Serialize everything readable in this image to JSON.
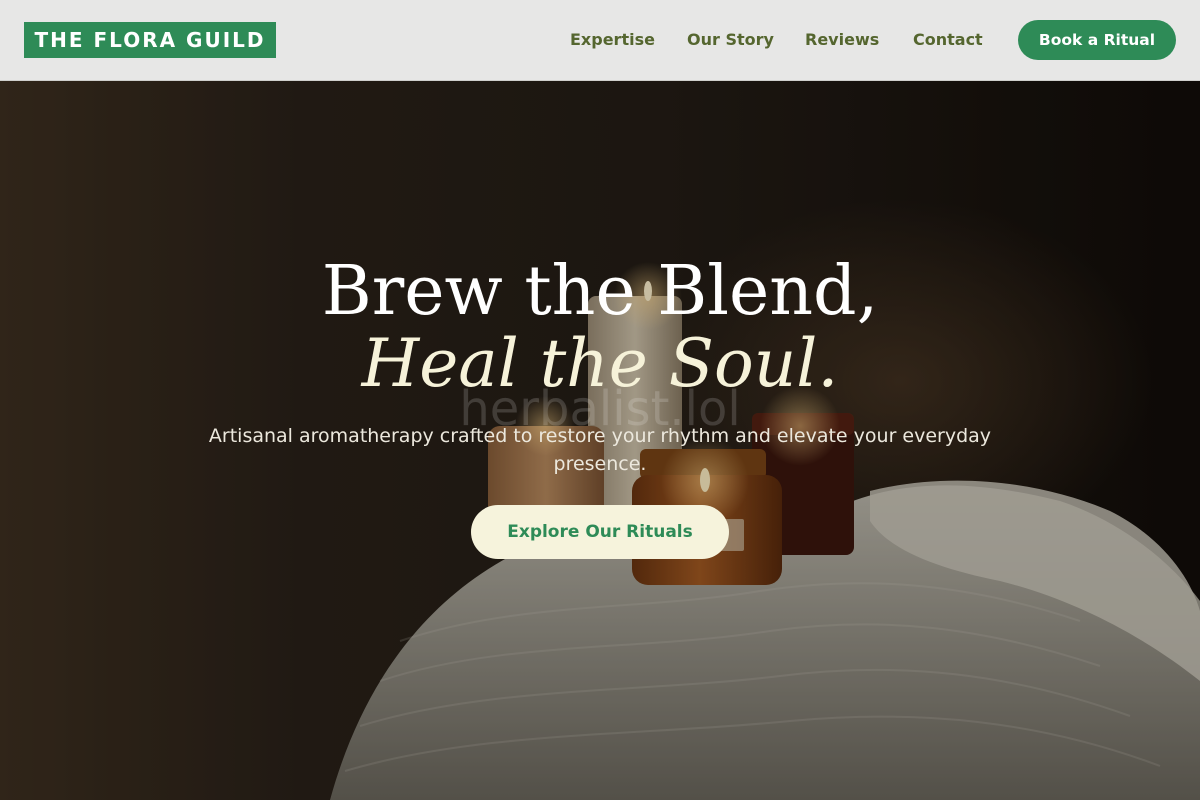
{
  "brand": {
    "logo_text": "THE FLORA GUILD",
    "primary_color": "#2e8b57",
    "cream_color": "#f6f3dc",
    "nav_color": "#55662f"
  },
  "nav": {
    "items": [
      {
        "label": "Expertise"
      },
      {
        "label": "Our Story"
      },
      {
        "label": "Reviews"
      },
      {
        "label": "Contact"
      }
    ],
    "book_label": "Book a Ritual"
  },
  "hero": {
    "headline_line1": "Brew the Blend,",
    "headline_line2": "Heal the Soul.",
    "watermark": "herbalist.lol",
    "subtitle": "Artisanal aromatherapy crafted to restore your rhythm and elevate your everyday presence.",
    "cta_label": "Explore Our Rituals"
  }
}
